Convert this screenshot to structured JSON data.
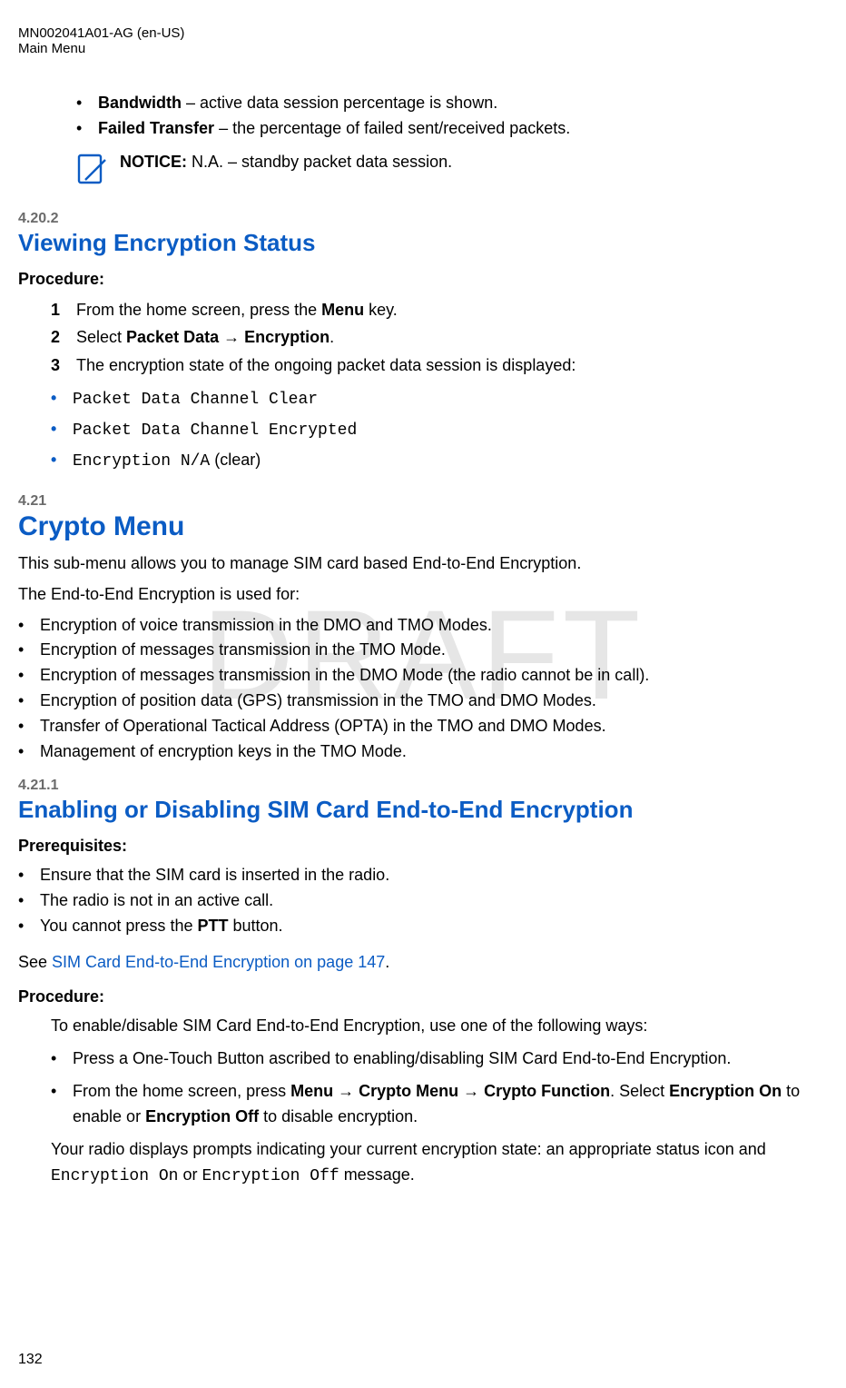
{
  "header": {
    "line1": "MN002041A01-AG (en-US)",
    "line2": "Main Menu"
  },
  "watermark": "DRAFT",
  "topBullets": {
    "bandwidth": {
      "term": "Bandwidth",
      "desc": " – active data session percentage is shown."
    },
    "failed": {
      "term": "Failed Transfer",
      "desc": " – the percentage of failed sent/received packets."
    }
  },
  "notice": {
    "label": "NOTICE:",
    "text": " N.A. – standby packet data session."
  },
  "sec4202": {
    "num": "4.20.2",
    "title": "Viewing Encryption Status",
    "procLabel": "Procedure:",
    "step1a": "From the home screen, press the ",
    "step1b": "Menu",
    "step1c": " key.",
    "step2a": "Select ",
    "step2b": "Packet Data",
    "step2arrow": " → ",
    "step2c": "Encryption",
    "step2d": ".",
    "step3": "The encryption state of the ongoing packet data session is displayed:",
    "enc1": "Packet Data Channel Clear",
    "enc2": "Packet Data Channel Encrypted",
    "enc3a": "Encryption N/A",
    "enc3b": " (clear)"
  },
  "sec421": {
    "num": "4.21",
    "title": "Crypto Menu",
    "intro": "This sub-menu allows you to manage SIM card based End-to-End Encryption.",
    "usedFor": "The End-to-End Encryption is used for:",
    "li1": "Encryption of voice transmission in the DMO and TMO Modes.",
    "li2": "Encryption of messages transmission in the TMO Mode.",
    "li3": "Encryption of messages transmission in the DMO Mode (the radio cannot be in call).",
    "li4": "Encryption of position data (GPS) transmission in the TMO and DMO Modes.",
    "li5": "Transfer of Operational Tactical Address (OPTA) in the TMO and DMO Modes.",
    "li6": "Management of encryption keys in the TMO Mode."
  },
  "sec4211": {
    "num": "4.21.1",
    "title": "Enabling or Disabling SIM Card End-to-End Encryption",
    "prereqLabel": "Prerequisites:",
    "pr1": "Ensure that the SIM card is inserted in the radio.",
    "pr2": "The radio is not in an active call.",
    "pr3a": "You cannot press the ",
    "pr3b": "PTT",
    "pr3c": " button.",
    "seeA": "See ",
    "seeLink": "SIM Card End-to-End Encryption on page 147",
    "seeB": ".",
    "procLabel": "Procedure:",
    "intro": "To enable/disable SIM Card End-to-End Encryption, use one of the following ways:",
    "b1": "Press a One-Touch Button ascribed to enabling/disabling SIM Card End-to-End Encryption.",
    "b2a": "From the home screen, press ",
    "b2b": "Menu",
    "b2arr1": " → ",
    "b2c": "Crypto Menu",
    "b2arr2": " → ",
    "b2d": "Crypto Function",
    "b2e": ". Select ",
    "b2f": "Encryption On",
    "b2g": " to enable or ",
    "b2h": "Encryption Off",
    "b2i": " to disable encryption.",
    "result1": "Your radio displays prompts indicating your current encryption state: an appropriate status icon and ",
    "result2": "Encryption On",
    "result3": " or ",
    "result4": "Encryption Off",
    "result5": " message."
  },
  "pageNumber": "132"
}
